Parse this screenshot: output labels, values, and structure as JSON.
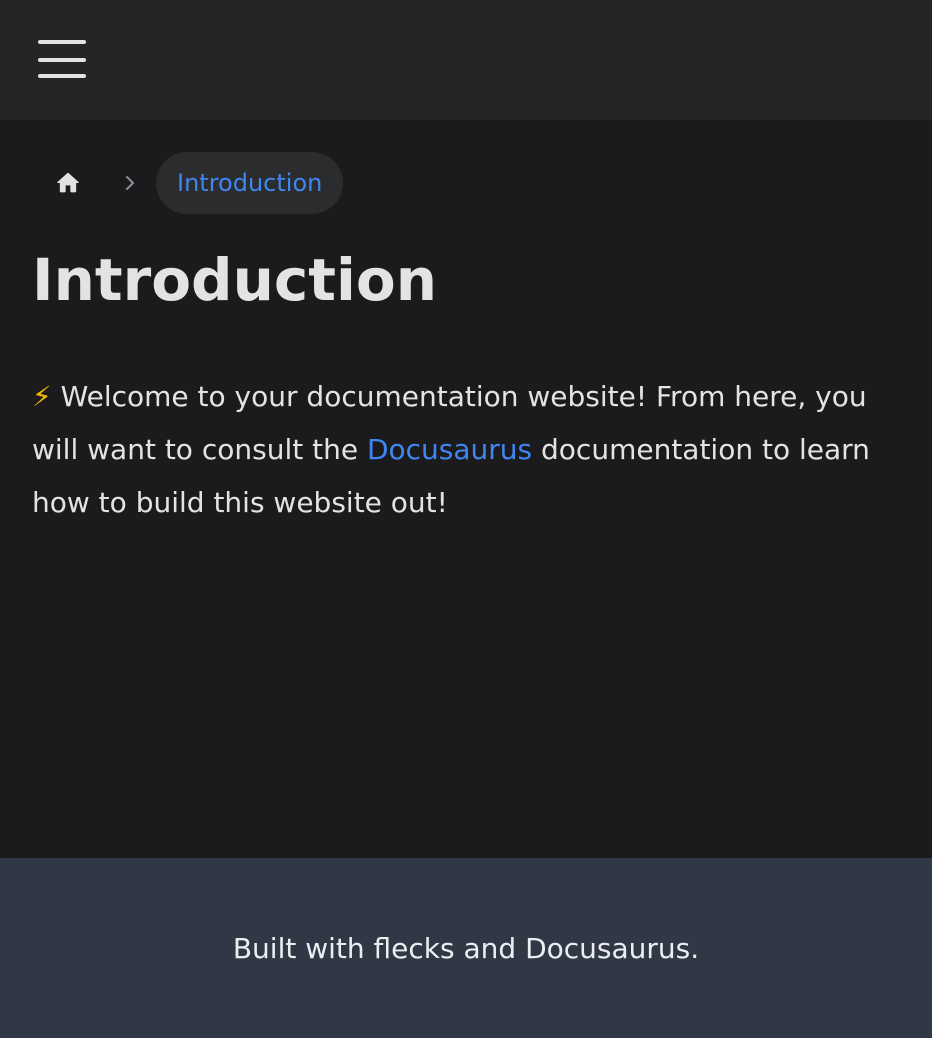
{
  "navbar": {
    "menu_icon": "hamburger-menu-icon"
  },
  "breadcrumb": {
    "home_icon": "home-icon",
    "separator_icon": "chevron-right-icon",
    "current": "Introduction"
  },
  "page": {
    "title": "Introduction",
    "intro_emoji": "⚡",
    "intro_before_link": " Welcome to your documentation website! From here, you will want to consult the ",
    "intro_link": "Docusaurus",
    "intro_after_link": " documentation to learn how to build this website out!"
  },
  "footer": {
    "text": "Built with flecks and Docusaurus."
  },
  "colors": {
    "navbar_bg": "#242526",
    "page_bg": "#1b1b1d",
    "footer_bg": "#303846",
    "link": "#3f86f0",
    "text": "#e3e3e3"
  }
}
